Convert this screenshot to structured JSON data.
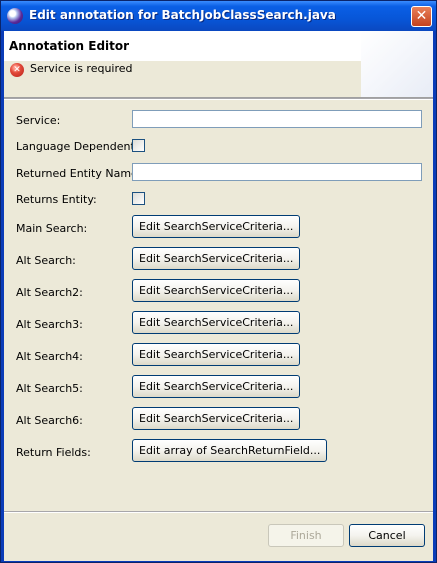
{
  "window": {
    "title": "Edit annotation for BatchJobClassSearch.java",
    "close_glyph": "✕"
  },
  "header": {
    "title": "Annotation Editor",
    "error_icon": "error-icon",
    "error_glyph": "✕",
    "error_message": "Service is required"
  },
  "form": {
    "service_label": "Service:",
    "service_value": "",
    "language_dependent_label": "Language Dependent:",
    "language_dependent_checked": false,
    "returned_entity_name_label": "Returned Entity Name:",
    "returned_entity_name_value": "",
    "returns_entity_label": "Returns Entity:",
    "returns_entity_checked": false,
    "main_search_label": "Main Search:",
    "main_search_button": "Edit SearchServiceCriteria...",
    "alt_search_label": "Alt Search:",
    "alt_search_button": "Edit SearchServiceCriteria...",
    "alt_search2_label": "Alt Search2:",
    "alt_search2_button": "Edit SearchServiceCriteria...",
    "alt_search3_label": "Alt Search3:",
    "alt_search3_button": "Edit SearchServiceCriteria...",
    "alt_search4_label": "Alt Search4:",
    "alt_search4_button": "Edit SearchServiceCriteria...",
    "alt_search5_label": "Alt Search5:",
    "alt_search5_button": "Edit SearchServiceCriteria...",
    "alt_search6_label": "Alt Search6:",
    "alt_search6_button": "Edit SearchServiceCriteria...",
    "return_fields_label": "Return Fields:",
    "return_fields_button": "Edit array of SearchReturnField..."
  },
  "footer": {
    "finish_label": "Finish",
    "finish_enabled": false,
    "cancel_label": "Cancel"
  }
}
